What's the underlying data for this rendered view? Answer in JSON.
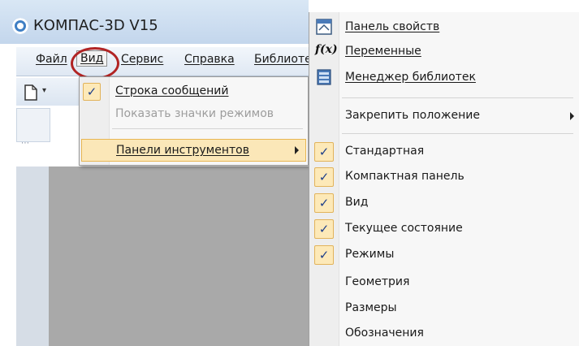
{
  "window": {
    "title": "КОМПАС-3D V15"
  },
  "menubar": {
    "items": [
      {
        "label": "Файл"
      },
      {
        "label": "Вид"
      },
      {
        "label": "Сервис"
      },
      {
        "label": "Справка"
      },
      {
        "label": "Библиоте"
      }
    ],
    "active_item": "Вид"
  },
  "view_menu": {
    "items": [
      {
        "label": "Строка сообщений",
        "checked": true,
        "enabled": true
      },
      {
        "label": "Показать значки режимов",
        "checked": false,
        "enabled": false
      },
      {
        "label": "Панели инструментов",
        "checked": false,
        "enabled": true,
        "submenu": true,
        "selected": true
      }
    ]
  },
  "toolbars_submenu": {
    "top_items": [
      {
        "label": "Панель свойств",
        "icon": "properties-panel-icon"
      },
      {
        "label": "Переменные",
        "icon": "fx-icon"
      },
      {
        "label": "Менеджер библиотек",
        "icon": "library-manager-icon"
      }
    ],
    "dock_item": {
      "label": "Закрепить положение",
      "submenu": true
    },
    "toolbar_items": [
      {
        "label": "Стандартная",
        "checked": true
      },
      {
        "label": "Компактная панель",
        "checked": true
      },
      {
        "label": "Вид",
        "checked": true
      },
      {
        "label": "Текущее состояние",
        "checked": true
      },
      {
        "label": "Режимы",
        "checked": true
      },
      {
        "label": "Геометрия",
        "checked": false
      },
      {
        "label": "Размеры",
        "checked": false
      },
      {
        "label": "Обозначения",
        "checked": false
      }
    ]
  },
  "colors": {
    "highlight_ring": "#b12424",
    "check_background": "#fde9b8",
    "selected_background": "#fbe7b8",
    "drawing_area": "#a9a9a9"
  }
}
